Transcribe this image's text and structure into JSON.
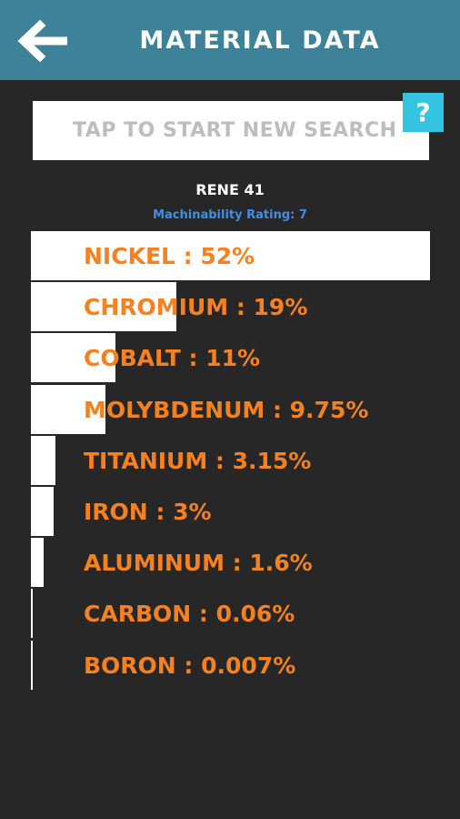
{
  "header": {
    "title": "MATERIAL DATA",
    "back_icon": "arrow-left-icon",
    "color": "#3d8298"
  },
  "search": {
    "placeholder": "TAP TO START NEW SEARCH"
  },
  "help": {
    "label": "?",
    "color": "#34c3e0"
  },
  "material": {
    "name": "RENE 41",
    "machinability": "Machinability Rating: 7"
  },
  "composition": [
    {
      "label": "NICKEL : 52%",
      "percent": 52
    },
    {
      "label": "CHROMIUM : 19%",
      "percent": 19
    },
    {
      "label": "COBALT : 11%",
      "percent": 11
    },
    {
      "label": "MOLYBDENUM : 9.75%",
      "percent": 9.75
    },
    {
      "label": "TITANIUM : 3.15%",
      "percent": 3.15
    },
    {
      "label": "IRON : 3%",
      "percent": 3
    },
    {
      "label": "ALUMINUM : 1.6%",
      "percent": 1.6
    },
    {
      "label": "CARBON : 0.06%",
      "percent": 0.06
    },
    {
      "label": "BORON : 0.007%",
      "percent": 0.007
    }
  ],
  "colors": {
    "label": "#f58120",
    "bar": "#ffffff",
    "machinability": "#3f8fe6"
  }
}
